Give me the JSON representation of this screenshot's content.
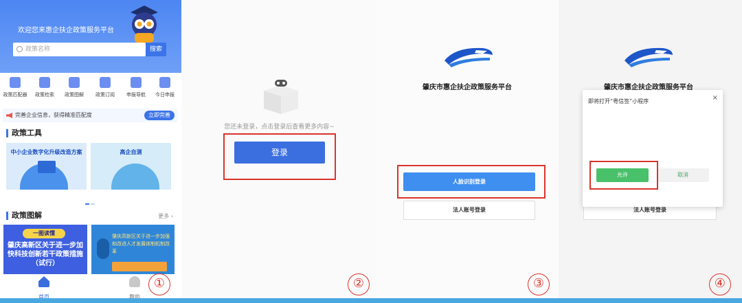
{
  "panel1": {
    "hero_title": "欢迎您来惠企扶企政策服务平台",
    "search_placeholder": "政策名称",
    "search_button": "搜索",
    "quick_items": [
      "政策匹配器",
      "政策检索",
      "政策图解",
      "政策订阅",
      "申报导航",
      "今日申报"
    ],
    "notice_text": "完善企业信息，获得精准匹配度",
    "notice_button": "立即完善",
    "section_tools": "政策工具",
    "banner_left": "中小企业数字化升级改造方案",
    "banner_right": "高企自测",
    "section_graphic": "政策图解",
    "more": "更多",
    "card_a_badge": "一图读懂",
    "card_a_text": "肇庆高新区关于进一步加快科技创新若干政策措施（试行）",
    "card_b_text": "肇庆高新区关于进一步加强和改进人才发展体制机制改革",
    "tab_home": "首页",
    "tab_mine": "我的",
    "step": "①"
  },
  "panel2": {
    "hint": "您还未登录，点击登录后查看更多内容~",
    "login_button": "登录",
    "step": "②"
  },
  "panel3": {
    "platform_title": "肇庆市惠企扶企政策服务平台",
    "face_login": "人脸识别登录",
    "corp_login": "法人账号登录",
    "step": "③"
  },
  "panel4": {
    "platform_title": "肇庆市惠企扶企政策服务平台",
    "dialog_title": "即将打开“粤信签”小程序",
    "close": "×",
    "allow": "允许",
    "deny": "取消",
    "corp_login": "法人账号登录",
    "step": "④"
  },
  "colors": {
    "primary": "#3b6fe0",
    "highlight": "#d9342b",
    "allow": "#49c06a"
  }
}
